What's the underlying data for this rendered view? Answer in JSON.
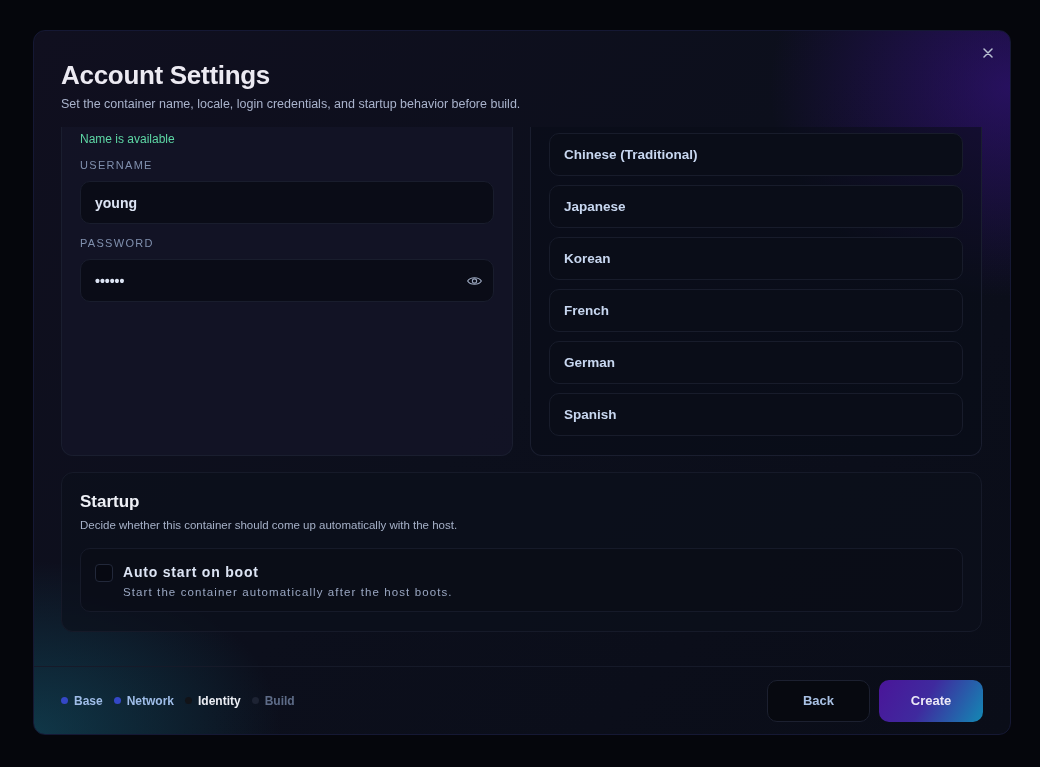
{
  "dialog": {
    "title": "Account Settings",
    "subtitle": "Set the container name, locale, login credentials, and startup behavior before build."
  },
  "account": {
    "availability": "Name is available",
    "fields": [
      {
        "label": "USERNAME",
        "value": "young",
        "kind": "text"
      },
      {
        "label": "PASSWORD",
        "value": "••••••",
        "kind": "password"
      }
    ]
  },
  "languages": [
    {
      "label": "Chinese (Traditional)",
      "selected": false
    },
    {
      "label": "Japanese",
      "selected": false
    },
    {
      "label": "Korean",
      "selected": false
    },
    {
      "label": "French",
      "selected": false
    },
    {
      "label": "German",
      "selected": false
    },
    {
      "label": "Spanish",
      "selected": false
    }
  ],
  "startup": {
    "title": "Startup",
    "description": "Decide whether this container should come up automatically with the host.",
    "options": [
      {
        "label": "Auto start on boot",
        "description": "Start the container automatically after the host boots.",
        "checked": false
      }
    ]
  },
  "footer": {
    "steps": [
      {
        "label": "Base",
        "completed": true,
        "selected": false
      },
      {
        "label": "Network",
        "completed": true,
        "selected": false
      },
      {
        "label": "Identity",
        "completed": false,
        "selected": true
      },
      {
        "label": "Build",
        "completed": false,
        "selected": false
      }
    ],
    "buttons": [
      {
        "label": "Back",
        "kind": "secondary"
      },
      {
        "label": "Create",
        "kind": "primary"
      }
    ]
  }
}
